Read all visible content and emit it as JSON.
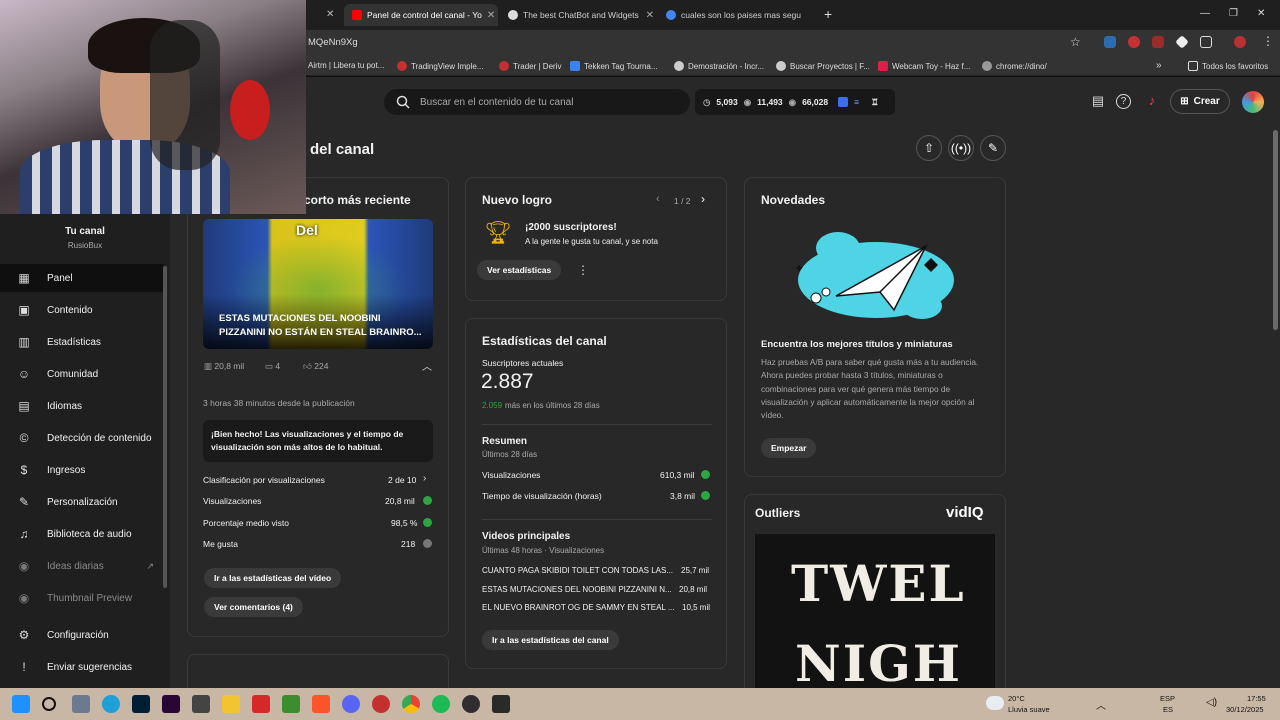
{
  "browser": {
    "tabs": [
      {
        "title": "Panel de control del canal - Yo",
        "active": true
      },
      {
        "title": "The best ChatBot and Widgets"
      },
      {
        "title": "cuales son los paises mas segu"
      }
    ],
    "url": "MQeNn9Xg",
    "bookmarks": [
      "Airtm | Libera tu pot...",
      "TradingView Imple...",
      "Trader | Deriv",
      "Tekken Tag Tourna...",
      "Demostración - Incr...",
      "Buscar Proyectos | F...",
      "Webcam Toy - Haz f...",
      "chrome://dino/",
      "Todos los favoritos"
    ]
  },
  "header": {
    "search_placeholder": "Buscar en el contenido de tu canal",
    "stat1": "5,093",
    "stat2": "11,493",
    "stat3": "66,028",
    "create_label": "Crear"
  },
  "sidebar": {
    "channel_name": "Tu canal",
    "channel_handle": "RusioBux",
    "items": [
      {
        "label": "Panel",
        "icon": "dashboard-icon"
      },
      {
        "label": "Contenido",
        "icon": "content-icon"
      },
      {
        "label": "Estadísticas",
        "icon": "analytics-icon"
      },
      {
        "label": "Comunidad",
        "icon": "community-icon"
      },
      {
        "label": "Idiomas",
        "icon": "subtitles-icon"
      },
      {
        "label": "Detección de contenido",
        "icon": "copyright-icon"
      },
      {
        "label": "Ingresos",
        "icon": "money-icon"
      },
      {
        "label": "Personalización",
        "icon": "customization-icon"
      },
      {
        "label": "Biblioteca de audio",
        "icon": "audio-library-icon"
      },
      {
        "label": "Ideas diarias",
        "icon": "vidiq-icon"
      },
      {
        "label": "Thumbnail Preview",
        "icon": "vidiq-icon"
      },
      {
        "label": "Configuración",
        "icon": "gear-icon"
      },
      {
        "label": "Enviar sugerencias",
        "icon": "feedback-icon"
      }
    ]
  },
  "main": {
    "title": "del canal",
    "latest_short": {
      "heading": "corto más reciente",
      "thumb_word": "Del",
      "thumb_caption": "ESTAS MUTACIONES DEL NOOBINI PIZZANINI NO ESTÁN EN STEAL BRAINRO...",
      "views": "20,8 mil",
      "comments": "4",
      "likes": "224",
      "published": "3 horas 38 minutos desde la publicación",
      "banner": "¡Bien hecho! Las visualizaciones y el tiempo de visualización son más altos de lo habitual.",
      "rows": [
        {
          "label": "Clasificación por visualizaciones",
          "value": "2 de 10"
        },
        {
          "label": "Visualizaciones",
          "value": "20,8 mil"
        },
        {
          "label": "Porcentaje medio visto",
          "value": "98,5 %"
        },
        {
          "label": "Me gusta",
          "value": "218"
        }
      ],
      "btn_stats": "Ir a las estadísticas del vídeo",
      "btn_comments": "Ver comentarios (4)"
    },
    "achievement": {
      "title": "Nuevo logro",
      "pager": "1 / 2",
      "headline": "¡2000 suscriptores!",
      "text": "A la gente le gusta tu canal, y se nota",
      "btn": "Ver estadísticas"
    },
    "channel_stats": {
      "title": "Estadísticas del canal",
      "subs_label": "Suscriptores actuales",
      "subs_value": "2.887",
      "subs_delta": "2.059",
      "subs_delta_text": "más en los últimos 28 días",
      "summary_title": "Resumen",
      "summary_period": "Últimos 28 días",
      "summary_rows": [
        {
          "label": "Visualizaciones",
          "value": "610,3 mil"
        },
        {
          "label": "Tiempo de visualización (horas)",
          "value": "3,8 mil"
        }
      ],
      "top_title": "Videos principales",
      "top_period": "Últimas 48 horas · Visualizaciones",
      "top_videos": [
        {
          "title": "CUANTO PAGA SKIBIDI TOILET CON TODAS LAS...",
          "views": "25,7 mil"
        },
        {
          "title": "ESTAS MUTACIONES DEL NOOBINI PIZZANINI N...",
          "views": "20,8 mil"
        },
        {
          "title": "EL NUEVO BRAINROT OG DE SAMMY EN STEAL ...",
          "views": "10,5 mil"
        }
      ],
      "btn": "Ir a las estadísticas del canal"
    },
    "news": {
      "title": "Novedades",
      "headline": "Encuentra los mejores títulos y miniaturas",
      "body": "Haz pruebas A/B para saber qué gusta más a tu audiencia. Ahora puedes probar hasta 3 títulos, miniaturas o combinaciones para ver qué genera más tiempo de visualización y aplicar automáticamente la mejor opción al vídeo.",
      "btn": "Empezar"
    },
    "outliers": {
      "title": "Outliers",
      "brand": "vidIQ",
      "image_text_1": "TWEL",
      "image_text_2": "NIGH"
    }
  },
  "taskbar": {
    "weather_temp": "20°C",
    "weather_text": "Lluvia suave",
    "lang1": "ESP",
    "lang2": "ES",
    "time": "17:55",
    "date": "30/12/2025"
  }
}
